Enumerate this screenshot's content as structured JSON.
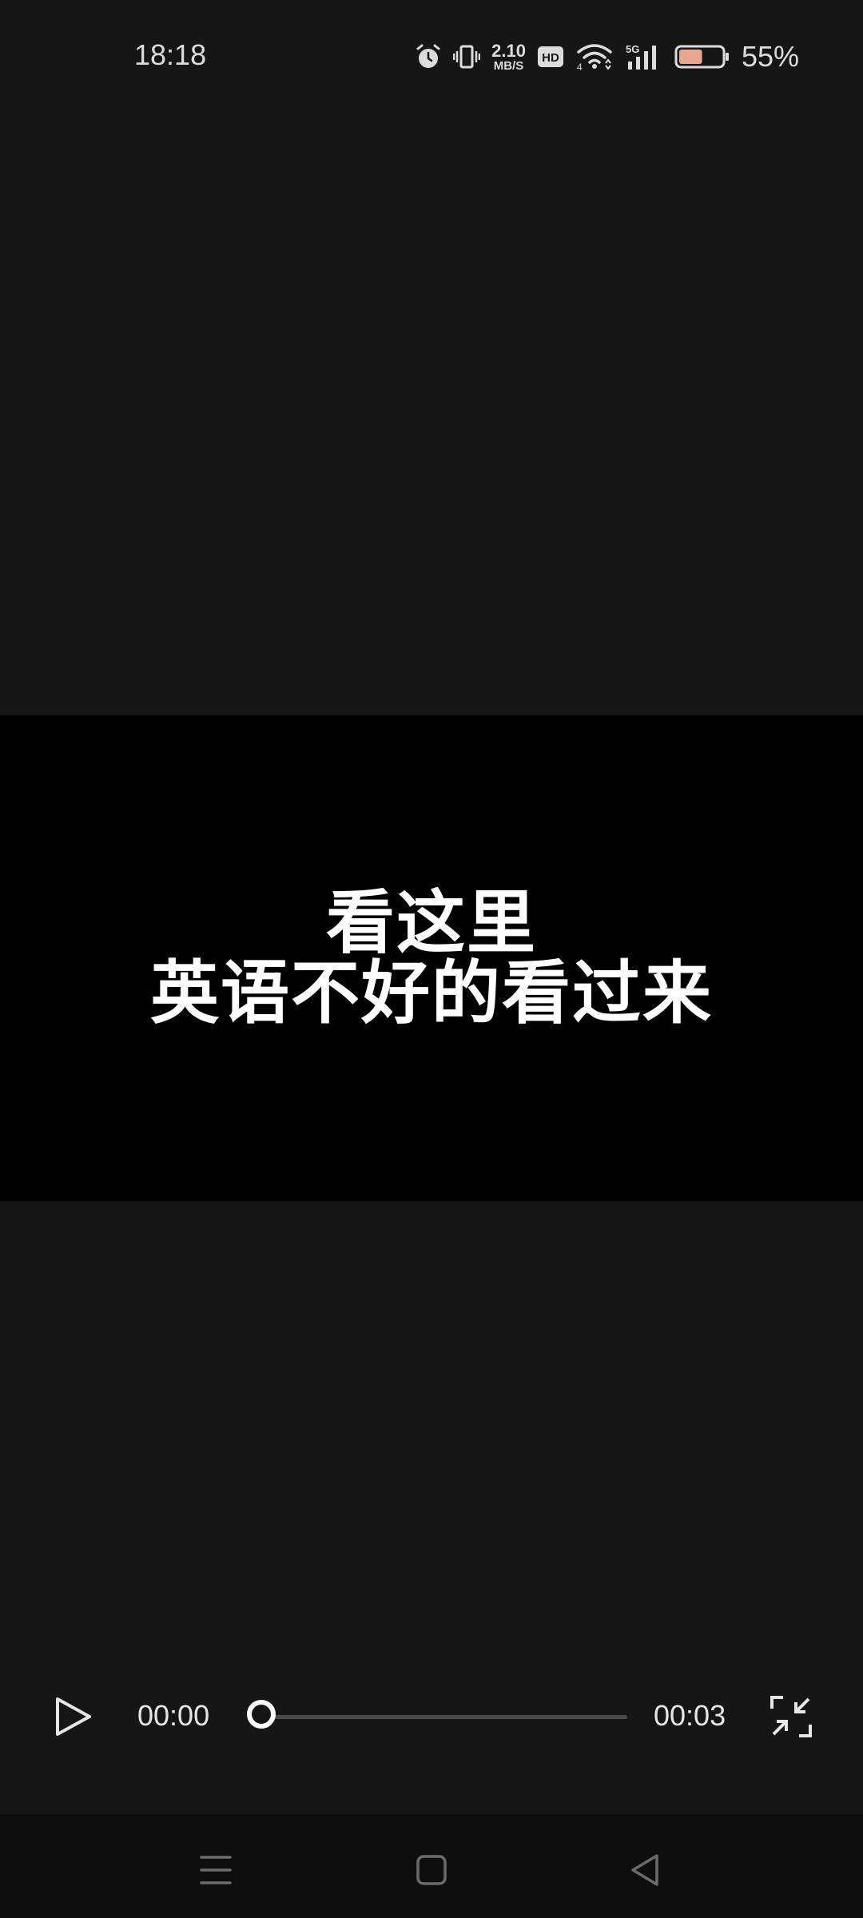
{
  "status_bar": {
    "time": "18:18",
    "net_speed_value": "2.10",
    "net_speed_unit": "MB/S",
    "network_type": "5G",
    "wifi_sub": "4",
    "hd_label": "HD",
    "battery_percent": "55%",
    "battery_level": 0.55,
    "battery_color": "#e8a890",
    "icons": [
      "alarm-icon",
      "vibrate-icon",
      "hd-icon",
      "wifi-icon",
      "signal-icon",
      "battery-icon"
    ]
  },
  "video": {
    "caption_lines": [
      "看这里",
      "英语不好的看过来"
    ],
    "background": "#000000"
  },
  "player": {
    "current_time": "00:00",
    "total_time": "00:03",
    "progress": 0.0,
    "icons": [
      "play-icon",
      "exit-fullscreen-icon"
    ]
  },
  "nav_bar": {
    "icons": [
      "menu-icon",
      "home-icon",
      "back-icon"
    ]
  },
  "colors": {
    "page_background": "#161616",
    "nav_background": "#0e0e0e",
    "text": "#e6e6e6"
  }
}
